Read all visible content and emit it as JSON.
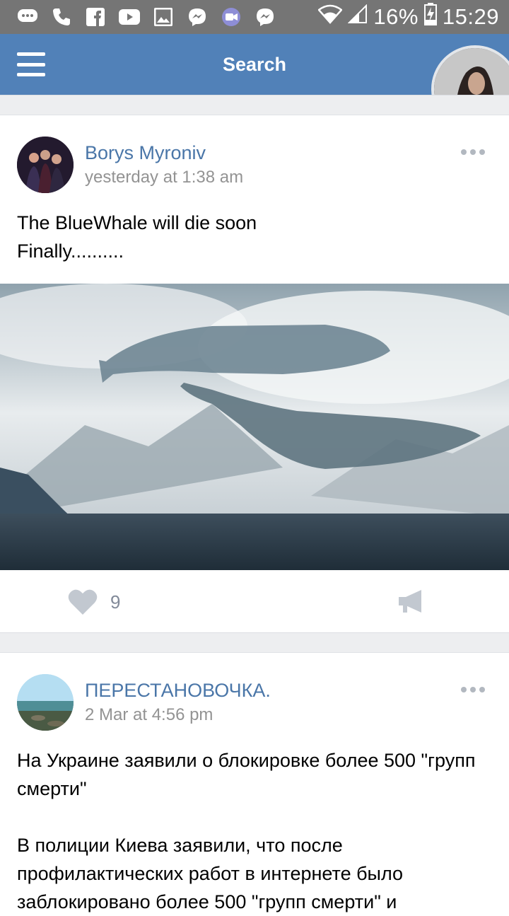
{
  "status_bar": {
    "battery": "16%",
    "time": "15:29",
    "icons_left": [
      "chat-bubble-icon",
      "phone-icon",
      "facebook-icon",
      "youtube-icon",
      "gallery-icon",
      "messenger-icon",
      "video-call-icon",
      "messenger-icon"
    ]
  },
  "header": {
    "title": "Search"
  },
  "posts": [
    {
      "author": "Borys Myroniv",
      "time": "yesterday at 1:38 am",
      "text": "The BlueWhale will die soon\nFinally..........",
      "likes": "9"
    },
    {
      "author": "ПЕРЕСТАНОВОЧКА.",
      "time": "2 Mar at 4:56 pm",
      "text": "На Украине заявили о блокировке более 500 \"групп смерти\"\n\nВ полиции Киева заявили, что после профилактических работ в интернете было заблокировано более 500 \"групп смерти\" и"
    }
  ],
  "colors": {
    "app_bar": "#5181b8",
    "link": "#4a76a8",
    "status_bar": "#757575"
  }
}
